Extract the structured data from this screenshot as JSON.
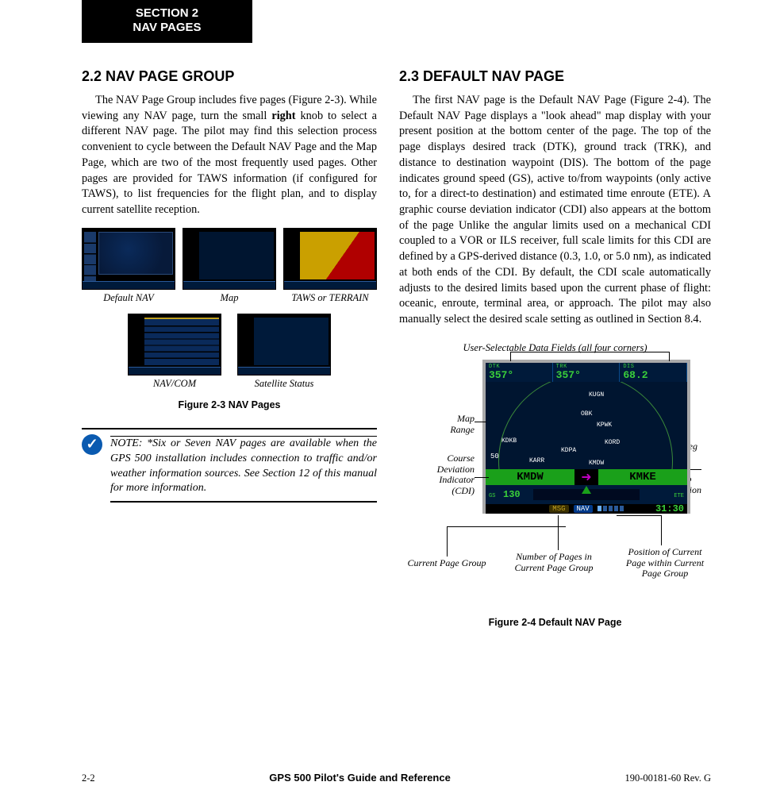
{
  "section_tab": {
    "line1": "SECTION 2",
    "line2": "NAV PAGES"
  },
  "left": {
    "heading": "2.2  NAV PAGE GROUP",
    "para1_a": "The NAV Page Group includes five pages (Figure 2-3).  While viewing any NAV page, turn the small ",
    "para1_bold": "right",
    "para1_b": " knob to select a different NAV page.  The pilot may find this selection process convenient to cycle between the Default NAV Page and the Map Page, which are two of the most frequently used pages.  Other pages are provided for TAWS information (if configured for TAWS), to list frequencies for the flight plan, and to display current satellite reception.",
    "thumbs": {
      "row1": [
        {
          "cap": "Default NAV"
        },
        {
          "cap": "Map"
        },
        {
          "cap": "TAWS or TERRAIN"
        }
      ],
      "row2": [
        {
          "cap": "NAV/COM"
        },
        {
          "cap": "Satellite Status"
        }
      ]
    },
    "fig_caption": "Figure 2-3  NAV Pages",
    "note": "NOTE:  *Six or Seven NAV pages are available when the GPS 500 installation includes connection to traffic and/or weather information sources.  See  Section 12 of this manual for more information."
  },
  "right": {
    "heading": "2.3  DEFAULT NAV PAGE",
    "para1": "The first NAV page is the Default NAV Page (Figure 2-4).  The Default NAV Page displays a \"look ahead\" map display with your present position at the bottom center of the page.  The top of the page displays desired track (DTK), ground track (TRK), and distance to destination waypoint (DIS).  The bottom of the page indicates ground speed (GS), active to/from waypoints (only active to, for a direct-to destination) and estimated time enroute (ETE).  A graphic course deviation indicator (CDI) also appears at the bottom of the page  Unlike the angular limits used on a mechanical CDI coupled to a VOR or ILS receiver, full scale limits for this CDI are defined by a GPS-derived distance (0.3, 1.0, or 5.0 nm), as indicated at both ends of the CDI.  By default, the CDI scale automatically adjusts to the desired limits based upon the current phase of flight: oceanic, enroute, terminal area, or approach.  The pilot may also manually select the desired scale setting as outlined in Section 8.4.",
    "fig24": {
      "top_label": "User-Selectable Data Fields (all four corners)",
      "dtk": {
        "lbl": "DTK",
        "val": "357°"
      },
      "trk": {
        "lbl": "TRK",
        "val": "357°"
      },
      "dis": {
        "lbl": "DIS",
        "val": "68.2"
      },
      "gs": {
        "lbl": "GS",
        "val": "130"
      },
      "ete": {
        "lbl": "ETE",
        "val": "31:30"
      },
      "wp_from": "KMDW",
      "wp_to": "KMKE",
      "range": "50",
      "waypoints": [
        "KUGN",
        "OBK",
        "KPWK",
        "KORD",
        "KDKB",
        "KDPA",
        "KARR",
        "KMDW"
      ],
      "msg": "MSG",
      "grp": "NAV",
      "side_labels": {
        "map_range": "Map\nRange",
        "cdi": "Course\nDeviation\nIndicator\n(CDI)",
        "active_leg": "Active Leg\nof Flight\nPlan, or\nDirect-to\nDestination",
        "cur_group": "Current Page Group",
        "num_pages": "Number of Pages in\nCurrent Page Group",
        "pos_page": "Position of Current\nPage within Current\nPage Group"
      },
      "caption": "Figure 2-4  Default NAV Page"
    }
  },
  "footer": {
    "left": "2-2",
    "mid": "GPS 500 Pilot's Guide and Reference",
    "right": "190-00181-60  Rev. G"
  }
}
